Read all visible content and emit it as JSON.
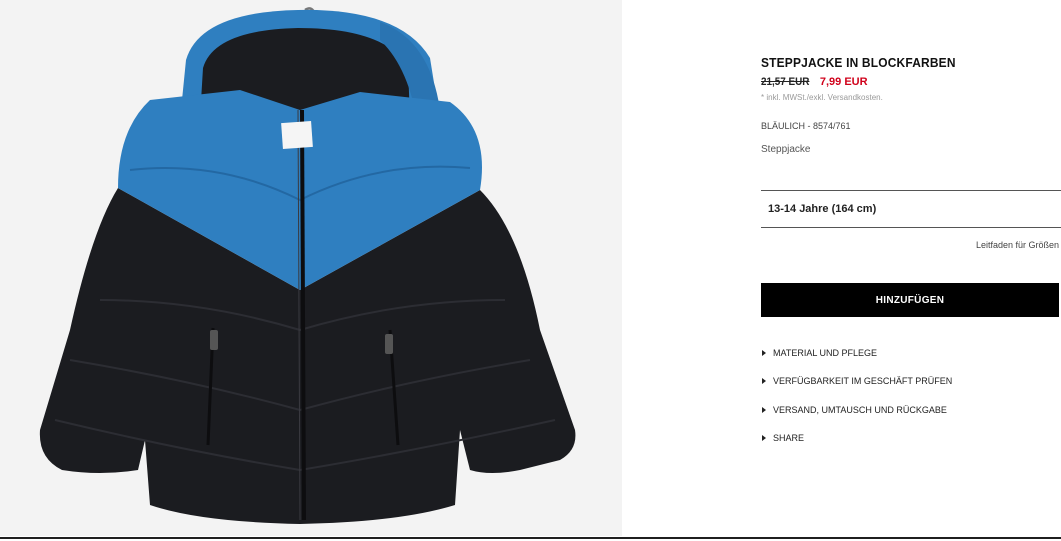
{
  "product": {
    "title": "STEPPJACKE IN BLOCKFARBEN",
    "price_old": "21,57 EUR",
    "price_new": "7,99 EUR",
    "tax_note": "* inkl. MWSt./exkl. Versandkosten.",
    "color_ref": "BLÄULICH - 8574/761",
    "description": "Steppjacke"
  },
  "size": {
    "selected": "13-14 Jahre (164 cm)",
    "guide_label": "Leitfaden für Größen"
  },
  "actions": {
    "add_label": "HINZUFÜGEN"
  },
  "accordion": [
    {
      "label": "MATERIAL UND PFLEGE"
    },
    {
      "label": "VERFÜGBARKEIT IM GESCHÄFT PRÜFEN"
    },
    {
      "label": "VERSAND, UMTAUSCH UND RÜCKGABE"
    },
    {
      "label": "SHARE"
    }
  ],
  "colors": {
    "accent_red": "#d0021b",
    "button_black": "#000000",
    "jacket_blue": "#2f7fc0",
    "jacket_black": "#1b1c20"
  }
}
